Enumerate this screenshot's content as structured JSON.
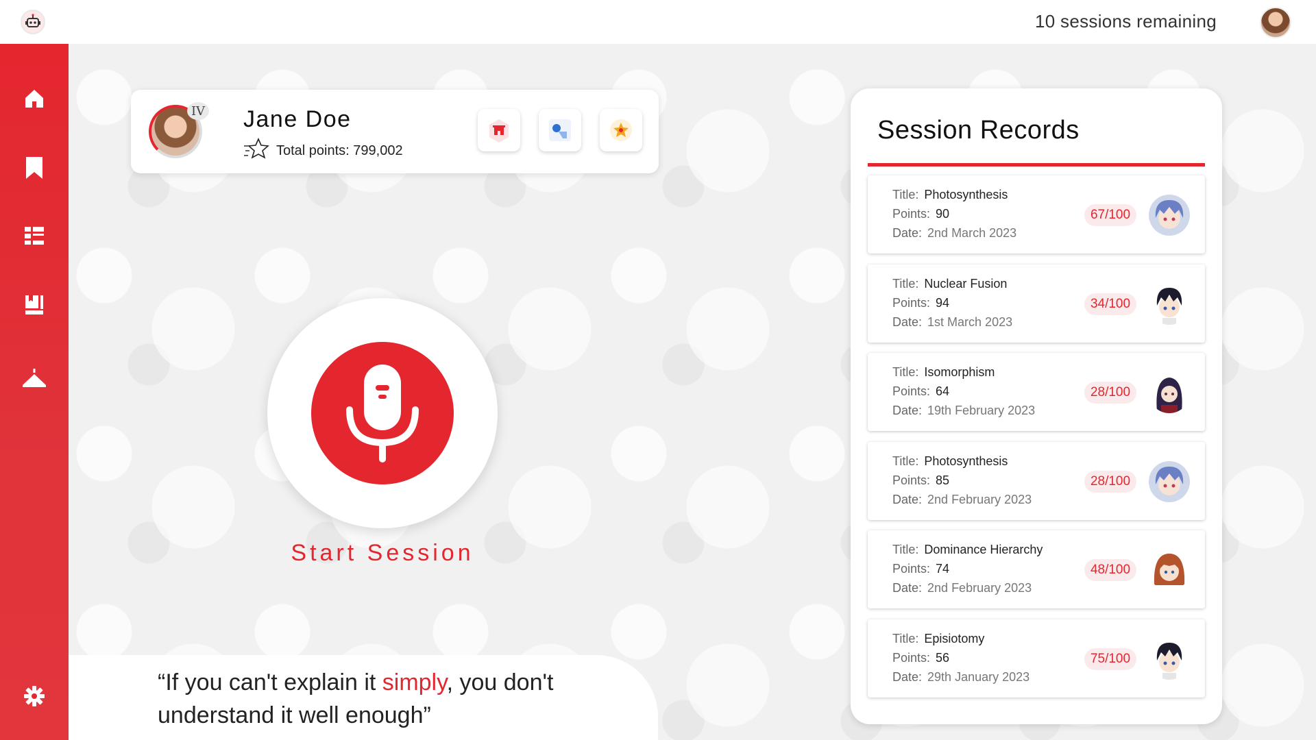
{
  "topbar": {
    "logo_icon": "robot-logo-icon",
    "sessions_remaining": "10 sessions remaining",
    "avatar_icon": "user-avatar"
  },
  "sidebar": {
    "items": [
      {
        "name": "home",
        "icon": "home-icon"
      },
      {
        "name": "bookmarks",
        "icon": "bookmark-icon"
      },
      {
        "name": "dashboard",
        "icon": "list-layout-icon"
      },
      {
        "name": "library",
        "icon": "book-icon"
      },
      {
        "name": "wardrobe",
        "icon": "hanger-icon"
      },
      {
        "name": "settings",
        "icon": "gear-icon"
      }
    ],
    "accent": "#e4262f"
  },
  "profile": {
    "name": "Jane Doe",
    "rank": "IV",
    "points_label": "Total points: 799,002",
    "badges": [
      {
        "name": "house-badge-icon",
        "color": "#e4262f"
      },
      {
        "name": "shapes-badge-icon",
        "color": "#2f6fd1"
      },
      {
        "name": "star-badge-icon",
        "color": "#f2a51c"
      }
    ]
  },
  "session": {
    "start_label": "Start Session"
  },
  "quote": {
    "before": "“If you can't explain it ",
    "highlight": "simply",
    "after": ", you don't understand it well enough”"
  },
  "records": {
    "title": "Session Records",
    "labels": {
      "title": "Title:",
      "points": "Points:",
      "date": "Date:"
    },
    "items": [
      {
        "title": "Photosynthesis",
        "points": "90",
        "date": "2nd March 2023",
        "score": "67/100",
        "avatar": "blue-hair-character"
      },
      {
        "title": "Nuclear Fusion",
        "points": "94",
        "date": "1st March 2023",
        "score": "34/100",
        "avatar": "dark-hair-boy-character"
      },
      {
        "title": "Isomorphism",
        "points": "64",
        "date": "19th February 2023",
        "score": "28/100",
        "avatar": "purple-hair-woman-character"
      },
      {
        "title": "Photosynthesis",
        "points": "85",
        "date": "2nd February 2023",
        "score": "28/100",
        "avatar": "blue-hair-character"
      },
      {
        "title": "Dominance Hierarchy",
        "points": "74",
        "date": "2nd February 2023",
        "score": "48/100",
        "avatar": "red-hair-girl-character"
      },
      {
        "title": "Episiotomy",
        "points": "56",
        "date": "29th January 2023",
        "score": "75/100",
        "avatar": "dark-hair-boy-character"
      }
    ]
  }
}
